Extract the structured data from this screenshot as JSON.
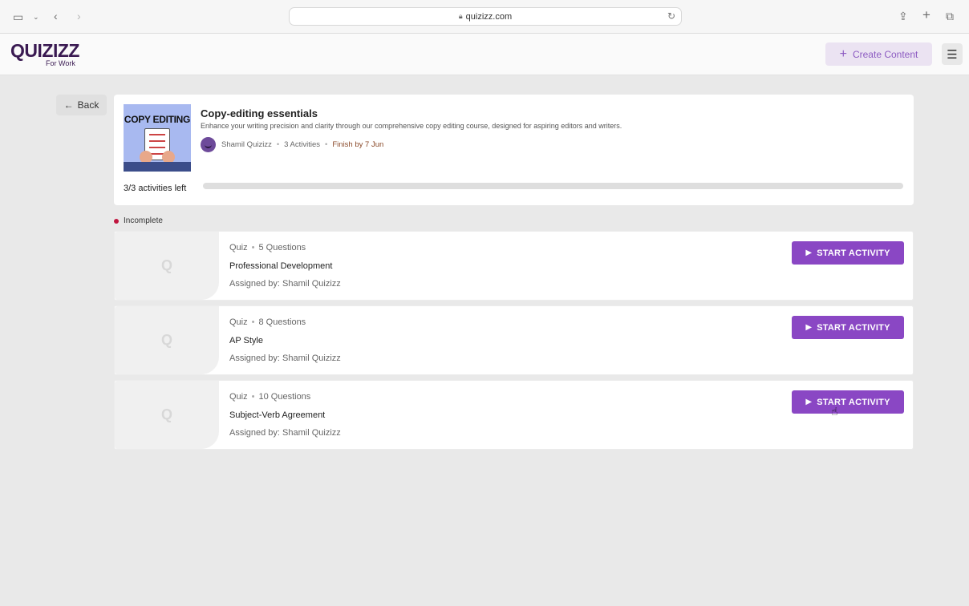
{
  "browser": {
    "url": "quizizz.com"
  },
  "header": {
    "logo_main": "QUIZIZZ",
    "logo_sub": "For Work",
    "create_label": "Create Content"
  },
  "back_label": "Back",
  "course": {
    "thumb_text": "COPY EDITING",
    "title": "Copy-editing essentials",
    "description": "Enhance your writing precision and clarity through our comprehensive copy editing course, designed for aspiring editors and writers.",
    "author": "Shamil Quizizz",
    "activities": "3 Activities",
    "finish": "Finish by 7 Jun",
    "progress_label": "3/3 activities left",
    "progress_fraction": 0
  },
  "status_label": "Incomplete",
  "activities": [
    {
      "type": "Quiz",
      "questions": "5 Questions",
      "title": "Professional Development",
      "assigned": "Assigned by: Shamil Quizizz",
      "button": "START ACTIVITY"
    },
    {
      "type": "Quiz",
      "questions": "8 Questions",
      "title": "AP Style",
      "assigned": "Assigned by: Shamil Quizizz",
      "button": "START ACTIVITY"
    },
    {
      "type": "Quiz",
      "questions": "10 Questions",
      "title": "Subject-Verb Agreement",
      "assigned": "Assigned by: Shamil Quizizz",
      "button": "START ACTIVITY"
    }
  ],
  "colors": {
    "accent": "#8a47c4",
    "status_incomplete": "#c0163f"
  },
  "icons": [
    "sidebar-icon",
    "back-arrow-icon",
    "forward-arrow-icon",
    "lock-icon",
    "reload-icon",
    "share-icon",
    "plus-icon",
    "tabs-icon",
    "menu-icon",
    "play-icon"
  ]
}
